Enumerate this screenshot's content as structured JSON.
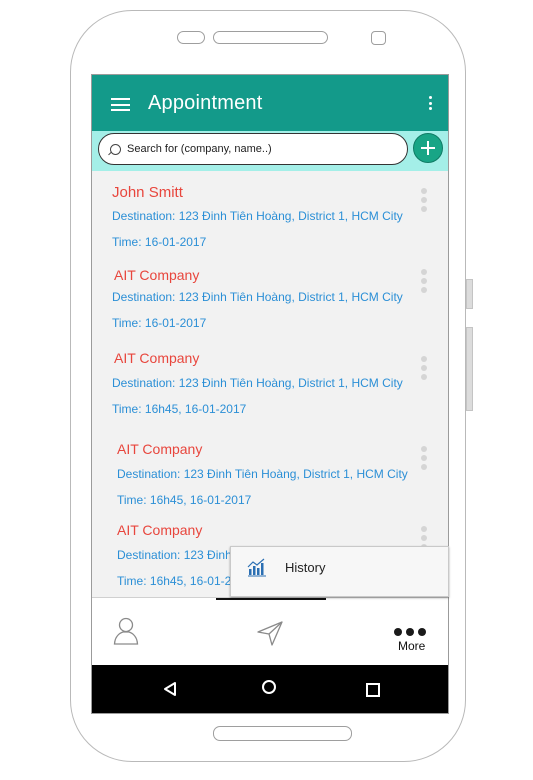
{
  "appbar": {
    "title": "Appointment"
  },
  "search": {
    "placeholder": "Search for (company, name..)"
  },
  "appointments": [
    {
      "name": "John Smitt",
      "destination": "Destination: 123 Đinh Tiên Hoàng, District 1, HCM City",
      "time": "Time: 16-01-2017"
    },
    {
      "name": "AIT Company",
      "destination": "Destination: 123 Đinh Tiên Hoàng, District 1, HCM City",
      "time": "Time: 16-01-2017"
    },
    {
      "name": "AIT Company",
      "destination": "Destination: 123 Đinh Tiên Hoàng, District 1, HCM City",
      "time": "Time: 16h45, 16-01-2017"
    },
    {
      "name": "AIT Company",
      "destination": "Destination: 123 Đinh Tiên Hoàng, District 1, HCM City",
      "time": "Time: 16h45, 16-01-2017"
    },
    {
      "name": "AIT Company",
      "destination": "Destination: 123 Đinh Tiên Hoàng, District 1, HCM City",
      "time": "Time: 16h45, 16-01-2017"
    }
  ],
  "popup_menu": {
    "items": [
      {
        "label": "History",
        "icon": "chart-icon"
      }
    ]
  },
  "bottom_nav": {
    "items": [
      {
        "icon": "person-icon"
      },
      {
        "icon": "send-icon"
      },
      {
        "icon": "more-dots-icon",
        "label": "More"
      }
    ]
  },
  "system_nav": {
    "icons": [
      "back-icon",
      "home-icon",
      "recent-apps-icon"
    ]
  },
  "colors": {
    "primary": "#139a8a",
    "search_bg": "#a4efe8",
    "name": "#e8463d",
    "detail": "#2b8fd6",
    "fab": "#18a586"
  }
}
